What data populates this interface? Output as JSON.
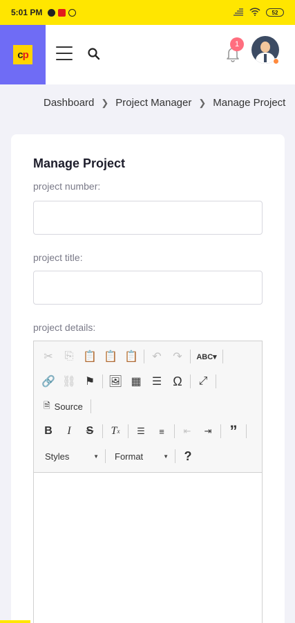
{
  "status_bar": {
    "time": "5:01 PM",
    "battery": "52"
  },
  "brand": {
    "logo_c": "c",
    "logo_p": "p"
  },
  "notifications": {
    "count": "1"
  },
  "breadcrumb": [
    "Dashboard",
    "Project Manager",
    "Manage Project"
  ],
  "form": {
    "title": "Manage Project",
    "project_number": {
      "label": "project number:",
      "value": ""
    },
    "project_title": {
      "label": "project title:",
      "value": ""
    },
    "project_details": {
      "label": "project details:"
    }
  },
  "editor_toolbar": {
    "source_label": "Source",
    "styles_label": "Styles",
    "format_label": "Format",
    "help_label": "?"
  },
  "colors": {
    "status_bar": "#ffe600",
    "brand": "#6f6cf5",
    "badge": "#ff6e7f"
  }
}
